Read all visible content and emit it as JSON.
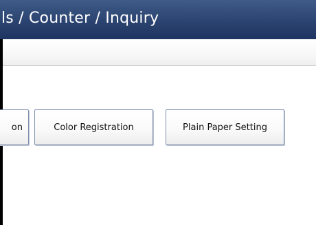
{
  "header": {
    "title": "ls / Counter / Inquiry"
  },
  "buttons": {
    "partial_label": "on",
    "color_registration_label": "Color Registration",
    "plain_paper_label": "Plain Paper Setting"
  },
  "colors": {
    "title_bar": "#2b4370",
    "title_text": "#ffffff",
    "button_border": "#7e8fad"
  }
}
